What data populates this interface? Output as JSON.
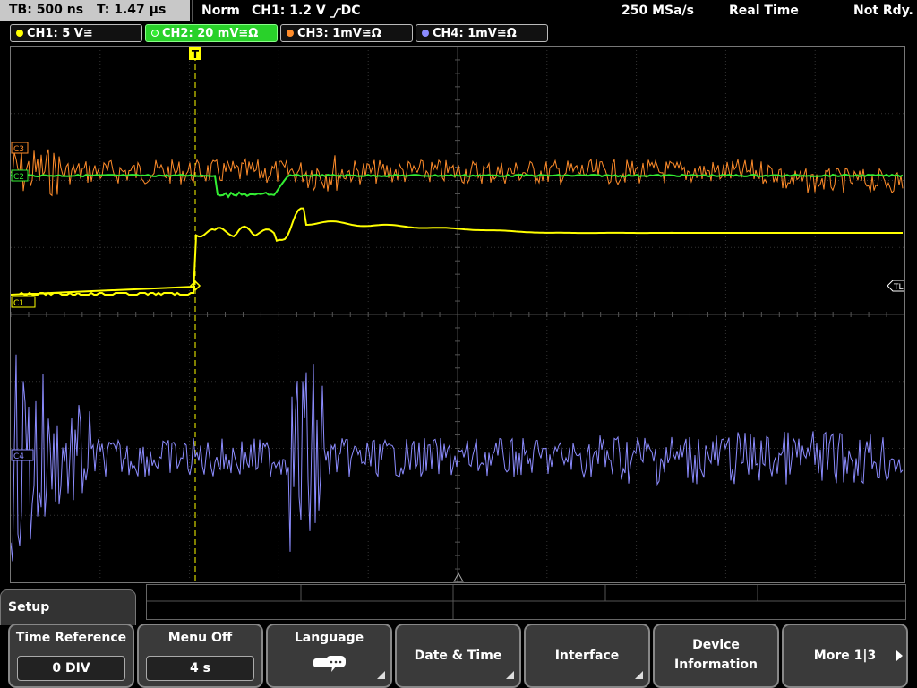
{
  "status": {
    "timebase": "TB: 500 ns",
    "trigger_pos": "T: 1.47 µs",
    "trigger_mode": "Norm",
    "trigger_info": "CH1: 1.2 V",
    "trigger_coupling": "DC",
    "sample_rate": "250 MSa/s",
    "acq_mode": "Real Time",
    "state": "Not Rdy."
  },
  "channels": [
    {
      "label": "CH1: 5 V≅",
      "color": "#ffff00"
    },
    {
      "label": "CH2: 20 mV≅Ω",
      "color": "#33ee33"
    },
    {
      "label": "CH3: 1mV≅Ω",
      "color": "#ff8c2a"
    },
    {
      "label": "CH4: 1mV≅Ω",
      "color": "#8c8cff"
    }
  ],
  "markers": {
    "c3": "C3",
    "c2": "C2",
    "c1": "C1",
    "c4": "C4",
    "tl": "TL",
    "trigger": "T"
  },
  "menu": {
    "title": "Setup",
    "keys": [
      {
        "label": "Time Reference",
        "value": "0 DIV"
      },
      {
        "label": "Menu Off",
        "value": "4 s"
      },
      {
        "label": "Language",
        "icon": "speech-bubble-icon"
      },
      {
        "label": "Date & Time"
      },
      {
        "label": "Interface"
      },
      {
        "label_line1": "Device",
        "label_line2": "Information"
      },
      {
        "label": "More 1|3"
      }
    ]
  }
}
